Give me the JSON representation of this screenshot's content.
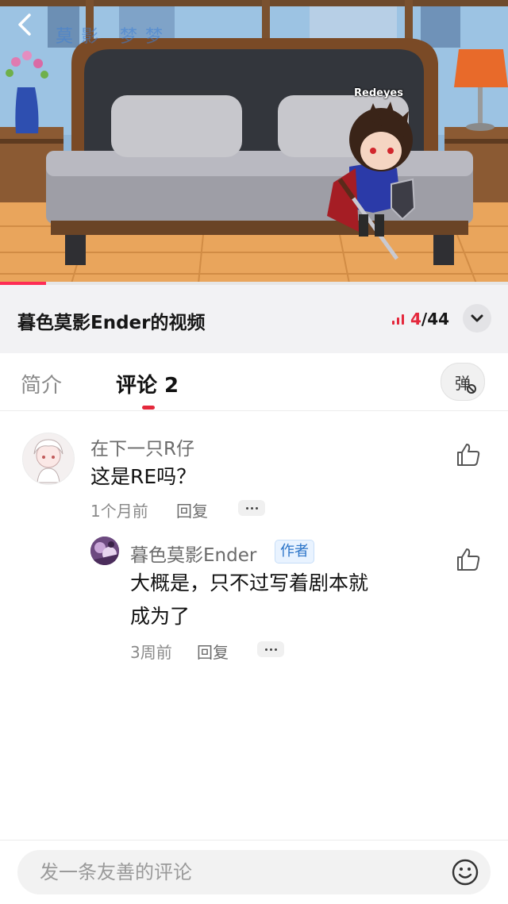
{
  "video": {
    "watermark": "莫影 梦梦",
    "character_name": "Redeyes",
    "progress": 0.09,
    "accent": "#fe2c55"
  },
  "playlist": {
    "title": "暮色莫影Ender的视频",
    "current": "4",
    "separator": "/",
    "total": "44",
    "icon": "chart-bars-icon",
    "accent": "#e4283c"
  },
  "tabs": {
    "intro": "简介",
    "comments": "评论 2",
    "danmaku": "弹"
  },
  "comments": [
    {
      "author": "在下一只R仔",
      "text": "这是RE吗？",
      "time": "1个月前",
      "reply_label": "回复"
    }
  ],
  "reply": {
    "author": "暮色莫影Ender",
    "badge": "作者",
    "text_line1": "大概是，只不过写着剧本就",
    "text_line2": "成为了",
    "time": "3周前",
    "reply_label": "回复"
  },
  "input": {
    "placeholder": "发一条友善的评论"
  },
  "icons": [
    "back-icon",
    "chevron-down-icon",
    "thumbs-up-icon",
    "more-dots-icon",
    "emoji-icon"
  ]
}
